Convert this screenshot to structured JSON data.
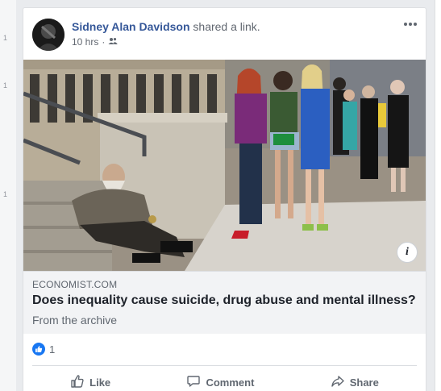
{
  "left_rail": {
    "markers": [
      "1",
      "1",
      "1"
    ]
  },
  "post": {
    "author": "Sidney Alan Davidson",
    "action": "shared a link.",
    "time": "10 hrs",
    "separator": "·",
    "audience_icon": "friends-icon",
    "more_icon": "more-options-icon"
  },
  "link": {
    "domain": "ECONOMIST.COM",
    "title": "Does inequality cause suicide, drug abuse and mental illness?",
    "description": "From the archive",
    "info_label": "i"
  },
  "reactions": {
    "type": "like",
    "count": "1"
  },
  "actions": {
    "like": "Like",
    "comment": "Comment",
    "share": "Share"
  },
  "colors": {
    "author_link": "#365899",
    "like_blue": "#1877f2",
    "muted_text": "#606770",
    "card_border": "#dddfe2",
    "link_bg": "#f2f3f5"
  }
}
